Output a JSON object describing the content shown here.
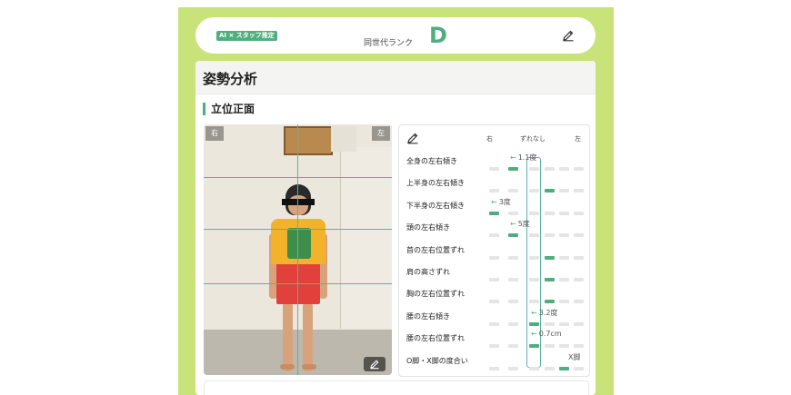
{
  "header": {
    "badge": "AI × スタッフ推定",
    "rank_label": "同世代ランク",
    "rank_value": "D",
    "edit_icon": "pencil-icon"
  },
  "panel": {
    "title": "姿勢分析",
    "section": "立位正面"
  },
  "photo": {
    "label_right": "右",
    "label_left": "左",
    "edit_icon": "pencil-icon"
  },
  "analysis": {
    "edit_icon": "pencil-icon",
    "col_right": "右",
    "col_center": "ずれなし",
    "col_left": "左",
    "rows": [
      {
        "label": "全身の左右傾き",
        "direction": "right",
        "value": "1.1度",
        "level": 1
      },
      {
        "label": "上半身の左右傾き",
        "direction": "none",
        "value": "",
        "level": 3
      },
      {
        "label": "下半身の左右傾き",
        "direction": "right",
        "value": "3度",
        "level": 0
      },
      {
        "label": "頭の左右傾き",
        "direction": "right",
        "value": "5度",
        "level": 1
      },
      {
        "label": "首の左右位置ずれ",
        "direction": "none",
        "value": "",
        "level": 3
      },
      {
        "label": "肩の高さずれ",
        "direction": "none",
        "value": "",
        "level": 3
      },
      {
        "label": "胸の左右位置ずれ",
        "direction": "none",
        "value": "",
        "level": 3
      },
      {
        "label": "腰の左右傾き",
        "direction": "right",
        "value": "3.2度",
        "level": 2
      },
      {
        "label": "腰の左右位置ずれ",
        "direction": "right",
        "value": "0.7cm",
        "level": 2
      },
      {
        "label": "O脚・X脚の度合い",
        "direction": "left",
        "value": "X脚",
        "level": 4
      }
    ]
  },
  "colors": {
    "accent": "#4fae7e",
    "frame": "#c9e27a",
    "inactive": "#e5e5e5"
  }
}
